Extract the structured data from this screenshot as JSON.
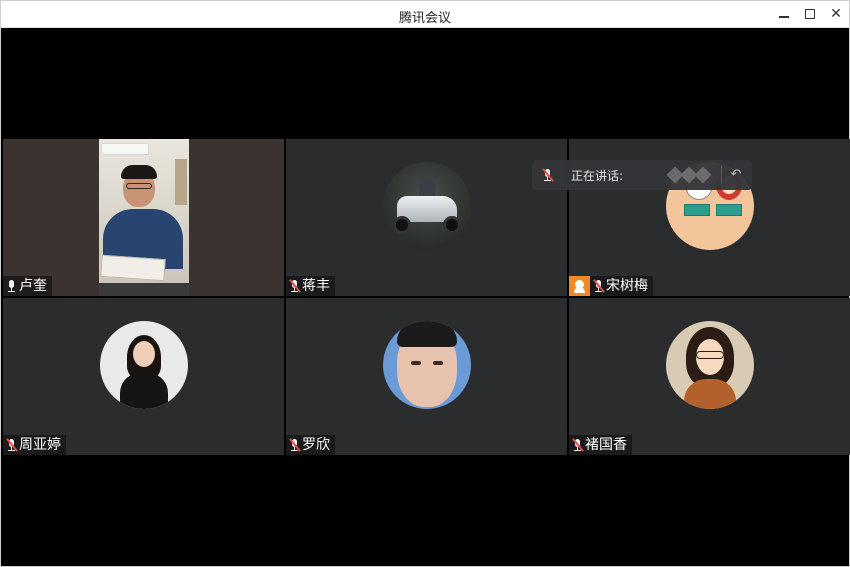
{
  "window": {
    "title": "腾讯会议"
  },
  "speaking_indicator": {
    "label": "正在讲话:"
  },
  "participants": [
    {
      "name": "卢奎",
      "mic_muted": false,
      "camera": "on"
    },
    {
      "name": "蒋丰",
      "mic_muted": true,
      "camera": "off",
      "avatar": "motorcycle"
    },
    {
      "name": "宋树梅",
      "mic_muted": true,
      "camera": "off",
      "avatar": "cartoon",
      "host": true
    },
    {
      "name": "周亚婷",
      "mic_muted": true,
      "camera": "off",
      "avatar": "portrait"
    },
    {
      "name": "罗欣",
      "mic_muted": true,
      "camera": "off",
      "avatar": "selfie"
    },
    {
      "name": "褚国香",
      "mic_muted": true,
      "camera": "off",
      "avatar": "illustration"
    }
  ],
  "colors": {
    "stage_background": "#000000",
    "tile_background": "#2b2c2e",
    "host_badge": "#f08a26",
    "muted_indicator": "#e04b4b"
  }
}
